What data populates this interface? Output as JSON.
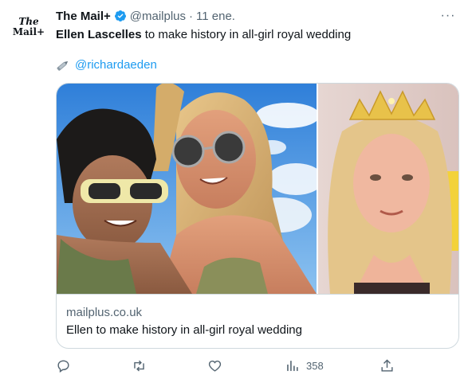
{
  "tweet": {
    "avatar_line1": "The",
    "avatar_line2": "Mail+",
    "display_name": "The Mail+",
    "handle": "@mailplus",
    "separator": "·",
    "date": "11 ene.",
    "more_label": "···",
    "text_bold": "Ellen Lascelles",
    "text_rest": " to make history in all-girl royal wedding",
    "byline_icon": "pen-icon",
    "byline_handle": "@richardaeden"
  },
  "card": {
    "domain": "mailplus.co.uk",
    "title": "Ellen to make history in all-girl royal wedding"
  },
  "actions": {
    "reply_icon": "reply-icon",
    "retweet_icon": "retweet-icon",
    "like_icon": "heart-icon",
    "views_icon": "views-icon",
    "views_count": "358",
    "share_icon": "share-icon"
  },
  "colors": {
    "text": "#0f1419",
    "secondary": "#536471",
    "link": "#1d9bf0",
    "border": "#cfd9de"
  }
}
